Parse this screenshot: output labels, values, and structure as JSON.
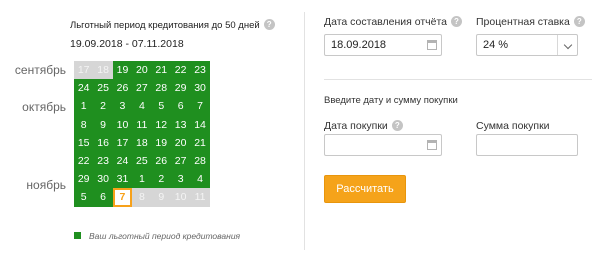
{
  "left": {
    "period_title": "Льготный период кредитования до 50 дней",
    "period_range": "19.09.2018 - 07.11.2018",
    "months": [
      "сентябрь",
      "октябрь",
      "ноябрь"
    ],
    "calendar": [
      [
        {
          "d": "17",
          "s": "out"
        },
        {
          "d": "18",
          "s": "out"
        },
        {
          "d": "19",
          "s": "in"
        },
        {
          "d": "20",
          "s": "in"
        },
        {
          "d": "21",
          "s": "in"
        },
        {
          "d": "22",
          "s": "in"
        },
        {
          "d": "23",
          "s": "in"
        }
      ],
      [
        {
          "d": "24",
          "s": "in"
        },
        {
          "d": "25",
          "s": "in"
        },
        {
          "d": "26",
          "s": "in"
        },
        {
          "d": "27",
          "s": "in"
        },
        {
          "d": "28",
          "s": "in"
        },
        {
          "d": "29",
          "s": "in"
        },
        {
          "d": "30",
          "s": "in"
        }
      ],
      [
        {
          "d": "1",
          "s": "in"
        },
        {
          "d": "2",
          "s": "in"
        },
        {
          "d": "3",
          "s": "in"
        },
        {
          "d": "4",
          "s": "in"
        },
        {
          "d": "5",
          "s": "in"
        },
        {
          "d": "6",
          "s": "in"
        },
        {
          "d": "7",
          "s": "in"
        }
      ],
      [
        {
          "d": "8",
          "s": "in"
        },
        {
          "d": "9",
          "s": "in"
        },
        {
          "d": "10",
          "s": "in"
        },
        {
          "d": "11",
          "s": "in"
        },
        {
          "d": "12",
          "s": "in"
        },
        {
          "d": "13",
          "s": "in"
        },
        {
          "d": "14",
          "s": "in"
        }
      ],
      [
        {
          "d": "15",
          "s": "in"
        },
        {
          "d": "16",
          "s": "in"
        },
        {
          "d": "17",
          "s": "in"
        },
        {
          "d": "18",
          "s": "in"
        },
        {
          "d": "19",
          "s": "in"
        },
        {
          "d": "20",
          "s": "in"
        },
        {
          "d": "21",
          "s": "in"
        }
      ],
      [
        {
          "d": "22",
          "s": "in"
        },
        {
          "d": "23",
          "s": "in"
        },
        {
          "d": "24",
          "s": "in"
        },
        {
          "d": "25",
          "s": "in"
        },
        {
          "d": "26",
          "s": "in"
        },
        {
          "d": "27",
          "s": "in"
        },
        {
          "d": "28",
          "s": "in"
        }
      ],
      [
        {
          "d": "29",
          "s": "in"
        },
        {
          "d": "30",
          "s": "in"
        },
        {
          "d": "31",
          "s": "in"
        },
        {
          "d": "1",
          "s": "in"
        },
        {
          "d": "2",
          "s": "in"
        },
        {
          "d": "3",
          "s": "in"
        },
        {
          "d": "4",
          "s": "in"
        }
      ],
      [
        {
          "d": "5",
          "s": "in"
        },
        {
          "d": "6",
          "s": "in"
        },
        {
          "d": "7",
          "s": "today"
        },
        {
          "d": "8",
          "s": "out"
        },
        {
          "d": "9",
          "s": "out"
        },
        {
          "d": "10",
          "s": "out"
        },
        {
          "d": "11",
          "s": "out"
        }
      ]
    ],
    "legend": "Ваш льготный период кредитования"
  },
  "right": {
    "report_date_label": "Дата составления отчёта",
    "report_date_value": "18.09.2018",
    "rate_label": "Процентная ставка",
    "rate_value": "24 %",
    "section_title": "Введите дату и сумму покупки",
    "purchase_date_label": "Дата покупки",
    "purchase_date_value": "",
    "purchase_amount_label": "Сумма покупки",
    "purchase_amount_value": "",
    "calculate_label": "Рассчитать"
  },
  "colors": {
    "grace_period": "#1f8f1f",
    "outside_period": "#d6d6d6",
    "today_accent": "#f7a11a",
    "button": "#f5a31a"
  },
  "icons": {
    "help": "question-circle-icon",
    "calendar": "calendar-icon",
    "dropdown": "chevron-down-icon"
  }
}
